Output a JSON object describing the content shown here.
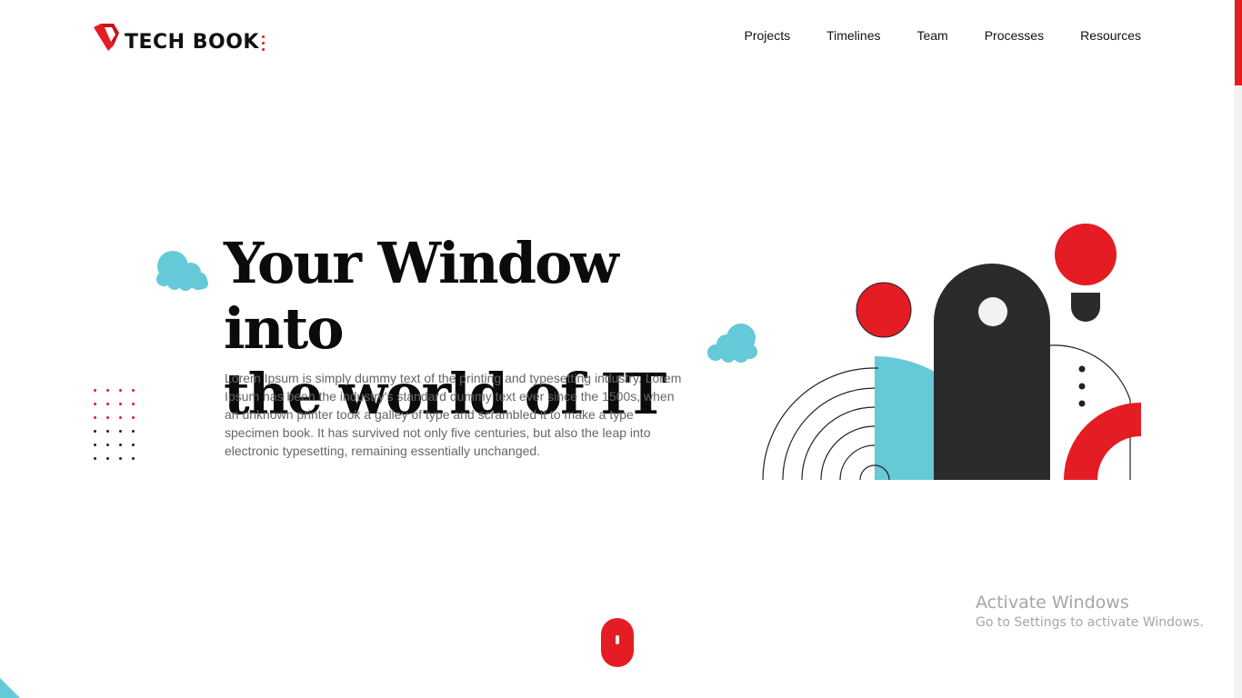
{
  "brand": {
    "name": "TECH BOOK"
  },
  "nav": {
    "items": [
      {
        "label": "Projects"
      },
      {
        "label": "Timelines"
      },
      {
        "label": "Team"
      },
      {
        "label": "Processes"
      },
      {
        "label": "Resources"
      }
    ]
  },
  "hero": {
    "title_line1": "Your Window into",
    "title_line2": "the world of IT",
    "description": "Lorem Ipsum is simply dummy text of the printing and typesetting industry. Lorem Ipsum has been the industry's standard dummy text ever since the 1500s, when an unknown printer took a galley of type and scrambled it to make a type specimen book. It has survived not only five centuries, but also the leap into electronic typesetting, remaining essentially unchanged."
  },
  "watermark": {
    "line1": "Activate Windows",
    "line2": "Go to Settings to activate Windows."
  },
  "colors": {
    "accent": "#e41c23",
    "teal": "#65c9d8",
    "dark": "#2b2b2b"
  },
  "icons": {
    "logo": "tech-book-logo-icon",
    "cloud": "cloud-icon",
    "scroll": "mouse-scroll-icon"
  }
}
